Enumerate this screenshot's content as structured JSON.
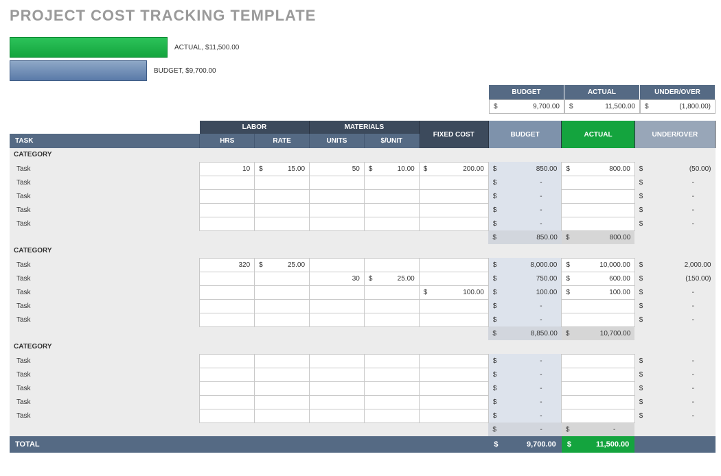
{
  "title": "PROJECT COST TRACKING TEMPLATE",
  "chart_data": {
    "type": "bar",
    "orientation": "horizontal",
    "series": [
      {
        "name": "ACTUAL",
        "value": 11500.0,
        "label": "ACTUAL,  $11,500.00",
        "color": "#14a43e"
      },
      {
        "name": "BUDGET",
        "value": 9700.0,
        "label": "BUDGET,  $9,700.00",
        "color": "#5a7aa8"
      }
    ],
    "xlim": [
      0,
      12000
    ]
  },
  "summary": {
    "headers": {
      "budget": "BUDGET",
      "actual": "ACTUAL",
      "under_over": "UNDER/OVER"
    },
    "values": {
      "budget": "9,700.00",
      "actual": "11,500.00",
      "under_over": "(1,800.00)"
    }
  },
  "columns": {
    "task": "TASK",
    "labor": "LABOR",
    "hrs": "HRS",
    "rate": "RATE",
    "materials": "MATERIALS",
    "units": "UNITS",
    "per_unit": "$/UNIT",
    "fixed": "FIXED COST",
    "budget": "BUDGET",
    "actual": "ACTUAL",
    "under_over": "UNDER/OVER"
  },
  "labels": {
    "category": "CATEGORY",
    "task": "Task",
    "total": "TOTAL",
    "currency": "$",
    "dash": "-"
  },
  "categories": [
    {
      "rows": [
        {
          "hrs": "10",
          "rate": "15.00",
          "units": "50",
          "per_unit": "10.00",
          "fixed": "200.00",
          "budget": "850.00",
          "actual": "800.00",
          "uo": "(50.00)"
        },
        {
          "budget": "-",
          "uo": "-"
        },
        {
          "budget": "-",
          "uo": "-"
        },
        {
          "budget": "-",
          "uo": "-"
        },
        {
          "budget": "-",
          "uo": "-"
        }
      ],
      "subtotal": {
        "budget": "850.00",
        "actual": "800.00"
      }
    },
    {
      "rows": [
        {
          "hrs": "320",
          "rate": "25.00",
          "budget": "8,000.00",
          "actual": "10,000.00",
          "uo": "2,000.00"
        },
        {
          "units": "30",
          "per_unit": "25.00",
          "budget": "750.00",
          "actual": "600.00",
          "uo": "(150.00)"
        },
        {
          "fixed": "100.00",
          "budget": "100.00",
          "actual": "100.00",
          "uo": "-"
        },
        {
          "budget": "-",
          "uo": "-"
        },
        {
          "budget": "-",
          "uo": "-"
        }
      ],
      "subtotal": {
        "budget": "8,850.00",
        "actual": "10,700.00"
      }
    },
    {
      "rows": [
        {
          "budget": "-",
          "uo": "-"
        },
        {
          "budget": "-",
          "uo": "-"
        },
        {
          "budget": "-",
          "uo": "-"
        },
        {
          "budget": "-",
          "uo": "-"
        },
        {
          "budget": "-",
          "uo": "-"
        }
      ],
      "subtotal": {
        "budget": "-",
        "actual": "-"
      }
    }
  ],
  "totals": {
    "budget": "9,700.00",
    "actual": "11,500.00"
  }
}
